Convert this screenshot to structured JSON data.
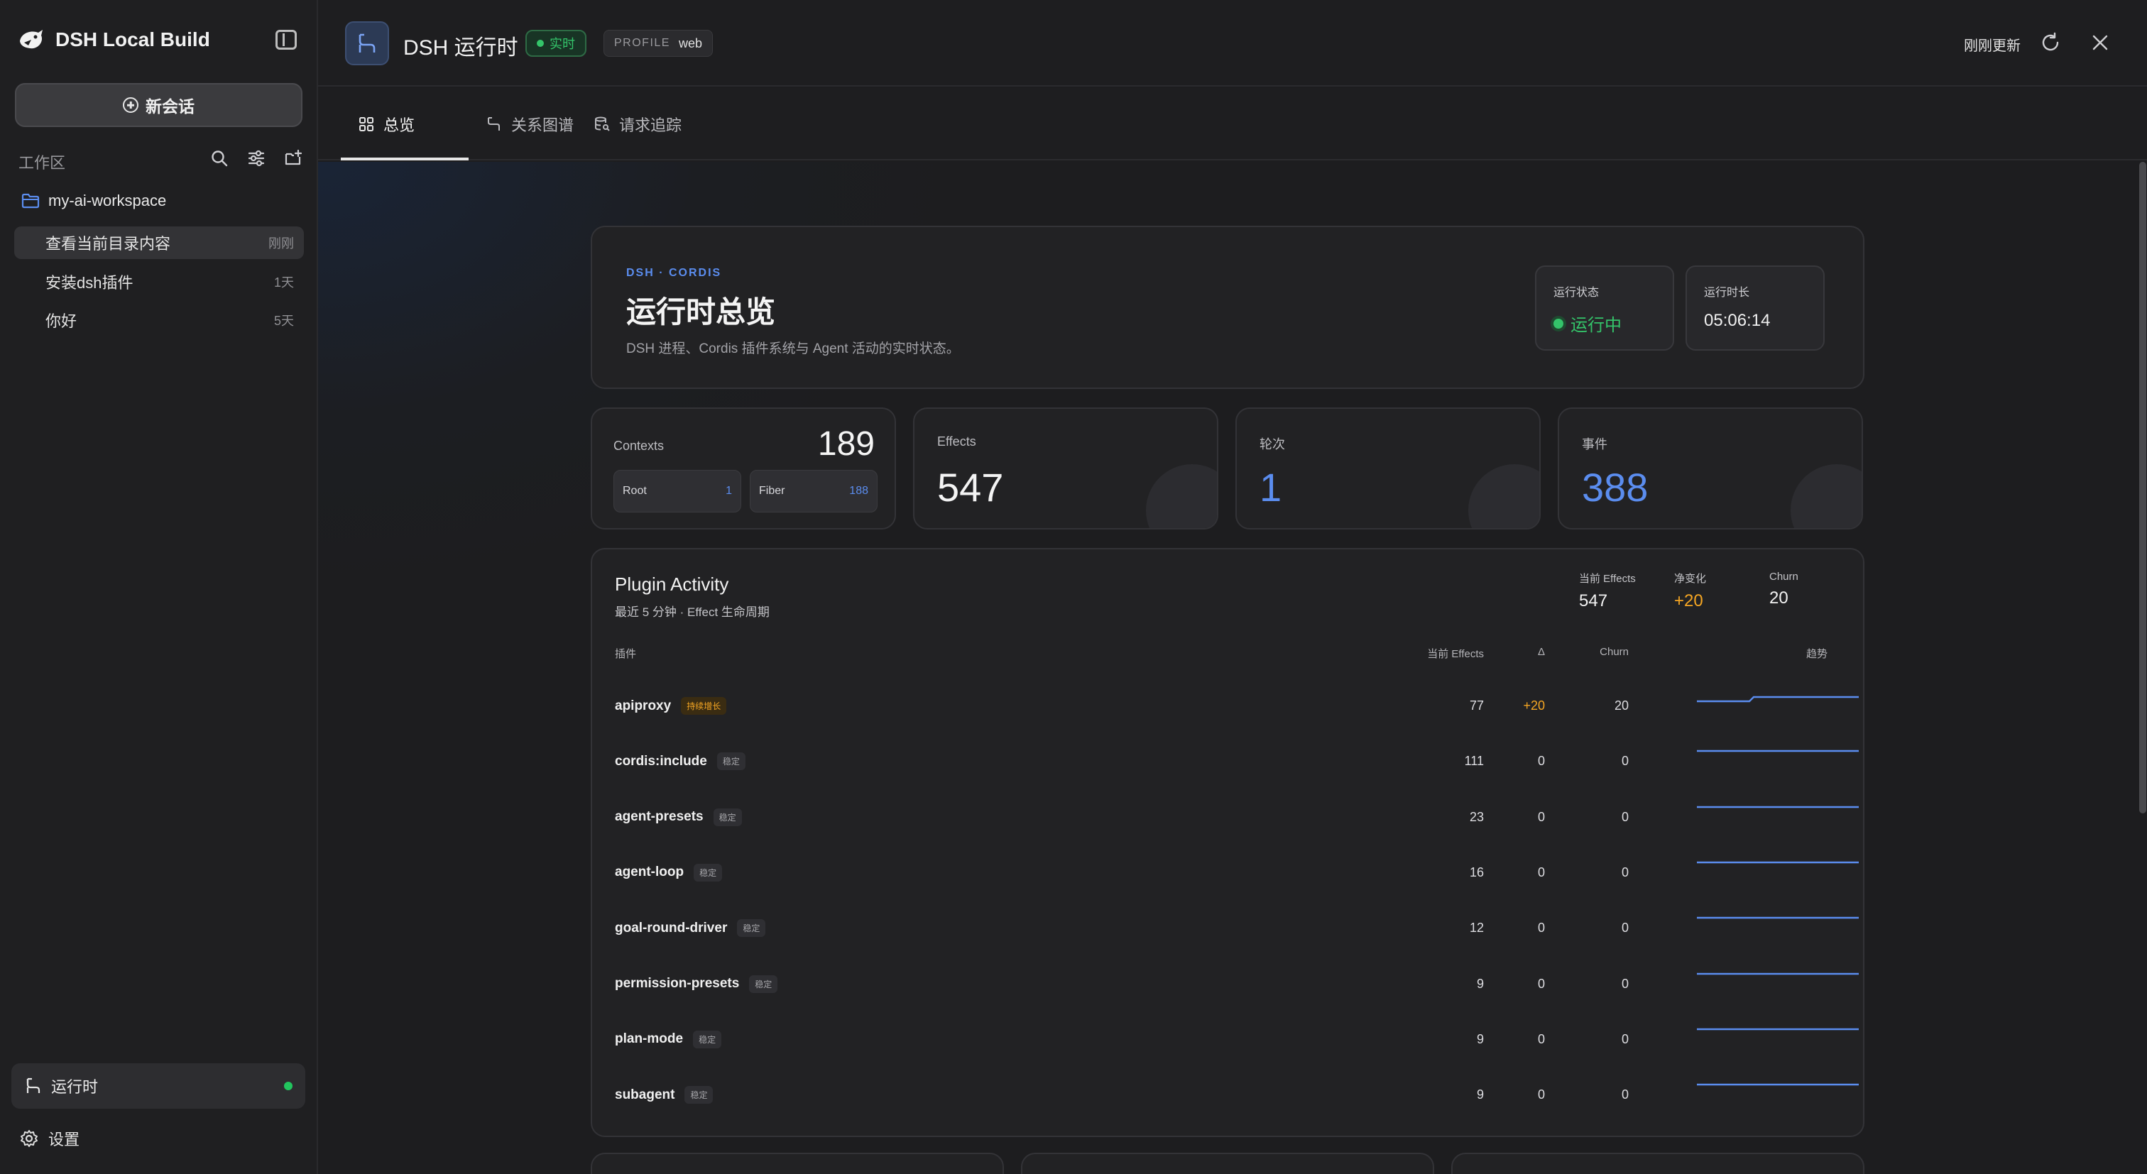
{
  "sidebar": {
    "brand": "DSH Local Build",
    "new_chat": "新会话",
    "workspace_label": "工作区",
    "folder": "my-ai-workspace",
    "sessions": [
      {
        "title": "查看当前目录内容",
        "time": "刚刚"
      },
      {
        "title": "安装dsh插件",
        "time": "1天"
      },
      {
        "title": "你好",
        "time": "5天"
      }
    ],
    "runtime": "运行时",
    "settings": "设置"
  },
  "header": {
    "title": "DSH 运行时",
    "live_badge": "实时",
    "profile_label": "PROFILE",
    "profile_value": "web",
    "updated": "刚刚更新"
  },
  "tabs": [
    {
      "label": "总览"
    },
    {
      "label": "关系图谱"
    },
    {
      "label": "请求追踪"
    }
  ],
  "hero": {
    "kicker": "DSH · CORDIS",
    "title": "运行时总览",
    "desc": "DSH 进程、Cordis 插件系统与 Agent 活动的实时状态。",
    "status_label": "运行状态",
    "status_value": "运行中",
    "uptime_label": "运行时长",
    "uptime_value": "05:06:14"
  },
  "kpis": {
    "contexts_label": "Contexts",
    "contexts_value": "189",
    "root_label": "Root",
    "root_value": "1",
    "fiber_label": "Fiber",
    "fiber_value": "188",
    "effects_label": "Effects",
    "effects_value": "547",
    "rounds_label": "轮次",
    "rounds_value": "1",
    "events_label": "事件",
    "events_value": "388"
  },
  "plugin_activity": {
    "title": "Plugin Activity",
    "subtitle": "最近 5 分钟 · Effect 生命周期",
    "summary": {
      "effects_label": "当前 Effects",
      "effects_value": "547",
      "net_label": "净变化",
      "net_value": "+20",
      "churn_label": "Churn",
      "churn_value": "20"
    },
    "columns": {
      "plugin": "插件",
      "effects": "当前 Effects",
      "delta": "Δ",
      "churn": "Churn",
      "trend": "趋势"
    },
    "rows": [
      {
        "name": "apiproxy",
        "tag": "持续增长",
        "effects": "77",
        "delta": "+20",
        "churn": "20"
      },
      {
        "name": "cordis:include",
        "tag": "稳定",
        "effects": "111",
        "delta": "0",
        "churn": "0"
      },
      {
        "name": "agent-presets",
        "tag": "稳定",
        "effects": "23",
        "delta": "0",
        "churn": "0"
      },
      {
        "name": "agent-loop",
        "tag": "稳定",
        "effects": "16",
        "delta": "0",
        "churn": "0"
      },
      {
        "name": "goal-round-driver",
        "tag": "稳定",
        "effects": "12",
        "delta": "0",
        "churn": "0"
      },
      {
        "name": "permission-presets",
        "tag": "稳定",
        "effects": "9",
        "delta": "0",
        "churn": "0"
      },
      {
        "name": "plan-mode",
        "tag": "稳定",
        "effects": "9",
        "delta": "0",
        "churn": "0"
      },
      {
        "name": "subagent",
        "tag": "稳定",
        "effects": "9",
        "delta": "0",
        "churn": "0"
      }
    ]
  },
  "colors": {
    "accent": "#5b8def",
    "live": "#34c46a",
    "warn": "#f5a623"
  }
}
